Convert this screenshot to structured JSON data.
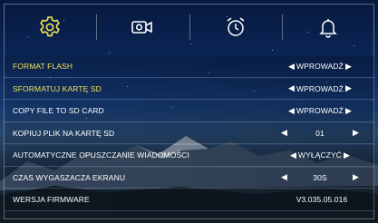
{
  "tabs": [
    {
      "icon": "gear-icon",
      "active": true
    },
    {
      "icon": "video-camera-icon",
      "active": false
    },
    {
      "icon": "alarm-clock-icon",
      "active": false
    },
    {
      "icon": "bell-icon",
      "active": false
    }
  ],
  "colors": {
    "highlight": "#f1e45a",
    "text": "#ffffff"
  },
  "menu": {
    "format_flash": {
      "label": "FORMAT FLASH",
      "value": "WPROWADŹ"
    },
    "format_sd": {
      "label": "SFORMATUJ KARTĘ SD",
      "value": "WPROWADŹ"
    },
    "copy_file": {
      "label": "COPY FILE TO SD CARD",
      "value": "WPROWADŹ"
    },
    "copy_file_pl": {
      "label": "KOPIUJ PLIK NA KARTĘ SD",
      "value": "01"
    },
    "auto_delete": {
      "label": "AUTOMATYCZNE OPUSZCZANIE WIADOMOŚCI",
      "value": "WYŁĄCZYĆ"
    },
    "screensaver": {
      "label": "CZAS WYGASZACZA EKRANU",
      "value": "30S"
    },
    "firmware": {
      "label": "WERSJA FIRMWARE",
      "value": "V3.035.05.016"
    }
  }
}
